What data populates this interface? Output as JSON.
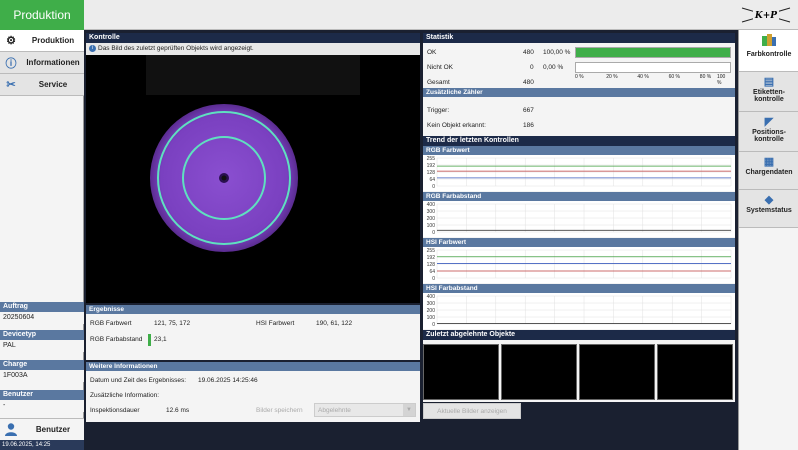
{
  "app": {
    "title": "Produktion",
    "logo": "K+P"
  },
  "left_nav": [
    {
      "label": "Produktion",
      "icon": "gears-icon"
    },
    {
      "label": "Informationen",
      "icon": "info-icon"
    },
    {
      "label": "Service",
      "icon": "tools-icon"
    }
  ],
  "left_info": {
    "auftrag_label": "Auftrag",
    "auftrag_value": "20250604",
    "devicetyp_label": "Devicetyp",
    "devicetyp_value": "PAL",
    "charge_label": "Charge",
    "charge_value": "1F003A",
    "benutzer_label": "Benutzer",
    "benutzer_value": "-",
    "user_button": "Benutzer",
    "datetime": "19.06.2025, 14:25"
  },
  "kontrolle": {
    "title": "Kontrolle",
    "info": "Das Bild des zuletzt geprüften Objekts wird angezeigt."
  },
  "ergebnisse": {
    "title": "Ergebnisse",
    "rgb_farbwert_label": "RGB Farbwert",
    "rgb_farbwert_value": "121, 75, 172",
    "hsi_farbwert_label": "HSI Farbwert",
    "hsi_farbwert_value": "190, 61, 122",
    "rgb_farbabstand_label": "RGB Farbabstand",
    "rgb_farbabstand_value": "23,1"
  },
  "weitere": {
    "title": "Weitere Informationen",
    "datum_label": "Datum und Zeit des Ergebnisses:",
    "datum_value": "19.06.2025 14:25:46",
    "zusatz_label": "Zusätzliche Information:",
    "dauer_label": "Inspektionsdauer",
    "dauer_value": "12.6 ms",
    "bilder_speichern": "Bilder speichern",
    "select_value": "Abgelehnte"
  },
  "statistik": {
    "title": "Statistik",
    "rows": [
      {
        "label": "OK",
        "count": "480",
        "percent": "100,00 %",
        "fraction": 1.0
      },
      {
        "label": "Nicht OK",
        "count": "0",
        "percent": "0,00 %",
        "fraction": 0.0
      },
      {
        "label": "Gesamt",
        "count": "480"
      }
    ],
    "axis": [
      "0 %",
      "20 %",
      "40 %",
      "60 %",
      "80 %",
      "100 %"
    ]
  },
  "zaehler": {
    "title": "Zusätzliche Zähler",
    "trigger_label": "Trigger:",
    "trigger_value": "667",
    "kein_label": "Kein Objekt erkannt:",
    "kein_value": "186"
  },
  "trend": {
    "title": "Trend der letzten Kontrollen",
    "charts": [
      {
        "title": "RGB Farbwert",
        "ticks": [
          "255",
          "192",
          "128",
          "64",
          "0"
        ],
        "lines": [
          0.53,
          0.71,
          0.29
        ],
        "colors": [
          "#c04040",
          "#40a040",
          "#4060c0"
        ]
      },
      {
        "title": "RGB Farbabstand",
        "ticks": [
          "400",
          "300",
          "200",
          "100",
          "0"
        ],
        "lines": [
          0.06
        ],
        "colors": [
          "#404040"
        ]
      },
      {
        "title": "HSI Farbwert",
        "ticks": [
          "255",
          "192",
          "128",
          "64",
          "0"
        ],
        "lines": [
          0.25,
          0.76,
          0.52
        ],
        "colors": [
          "#c04040",
          "#40a040",
          "#4060c0"
        ]
      },
      {
        "title": "HSI Farbabstand",
        "ticks": [
          "400",
          "300",
          "200",
          "100",
          "0"
        ],
        "lines": [
          0.02
        ],
        "colors": [
          "#404040"
        ]
      }
    ]
  },
  "abgelehnt": {
    "title": "Zuletzt abgelehnte Objekte",
    "button": "Aktuelle Bilder anzeigen"
  },
  "right_nav": [
    {
      "label": "Farbkontrolle",
      "icon": "color-icon"
    },
    {
      "label": "Etiketten-kontrolle",
      "icon": "label-icon"
    },
    {
      "label": "Positions-kontrolle",
      "icon": "position-icon"
    },
    {
      "label": "Chargendaten",
      "icon": "grid-icon"
    },
    {
      "label": "Systemstatus",
      "icon": "warning-icon"
    }
  ]
}
